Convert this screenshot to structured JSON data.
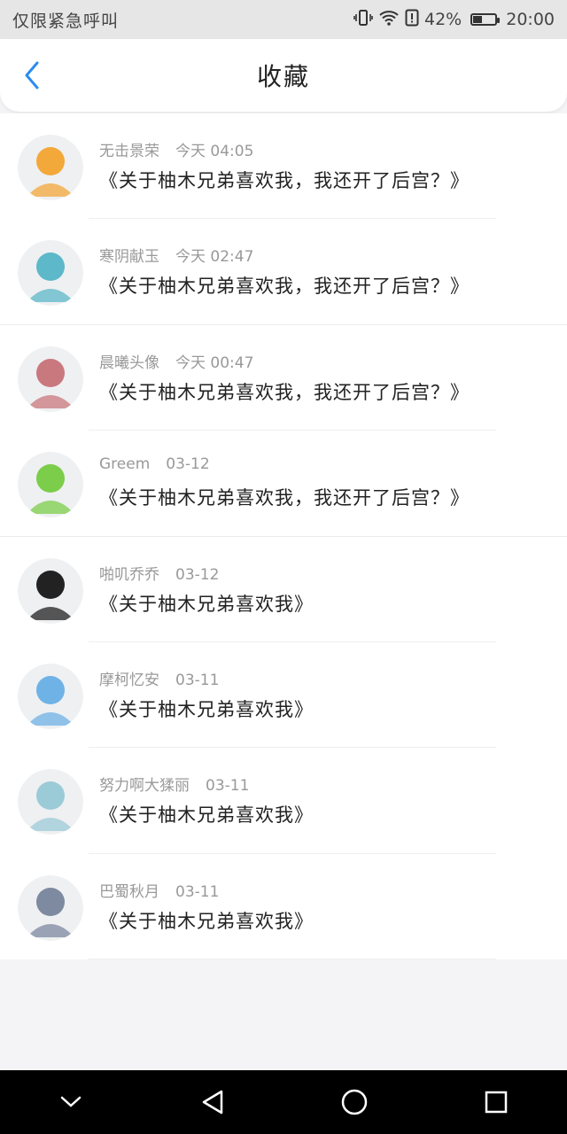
{
  "status_bar": {
    "carrier": "仅限紧急呼叫",
    "battery_percent": "42%",
    "battery_level": 0.42,
    "time": "20:00",
    "icons": [
      "vibrate-icon",
      "wifi-icon",
      "sim-alert-icon",
      "battery-icon"
    ]
  },
  "header": {
    "title": "收藏",
    "back_icon": "chevron-left-icon"
  },
  "favorites": [
    {
      "author": "无击景荣",
      "time": "今天 04:05",
      "title": "《关于柚木兄弟喜欢我，我还开了后宫？》",
      "avatar_color": "#f3a83a"
    },
    {
      "author": "寒阴献玉",
      "time": "今天 02:47",
      "title": "《关于柚木兄弟喜欢我，我还开了后宫？》",
      "avatar_color": "#5db8c9"
    },
    {
      "author": "晨曦头像",
      "time": "今天 00:47",
      "title": "《关于柚木兄弟喜欢我，我还开了后宫？》",
      "avatar_color": "#c9787e"
    },
    {
      "author": "Greem",
      "time": "03-12",
      "title": "《关于柚木兄弟喜欢我，我还开了后宫？》",
      "avatar_color": "#7ccd4a"
    },
    {
      "author": "啪叽乔乔",
      "time": "03-12",
      "title": "《关于柚木兄弟喜欢我》",
      "avatar_color": "#222222"
    },
    {
      "author": "摩柯忆安",
      "time": "03-11",
      "title": "《关于柚木兄弟喜欢我》",
      "avatar_color": "#6fb2e6"
    },
    {
      "author": "努力啊大猱丽",
      "time": "03-11",
      "title": "《关于柚木兄弟喜欢我》",
      "avatar_color": "#9ccbd8"
    },
    {
      "author": "巴蜀秋月",
      "time": "03-11",
      "title": "《关于柚木兄弟喜欢我》",
      "avatar_color": "#7d8aa0"
    }
  ],
  "nav": {
    "icons": [
      "chevron-down-icon",
      "back-triangle-icon",
      "home-circle-icon",
      "recents-square-icon"
    ]
  }
}
